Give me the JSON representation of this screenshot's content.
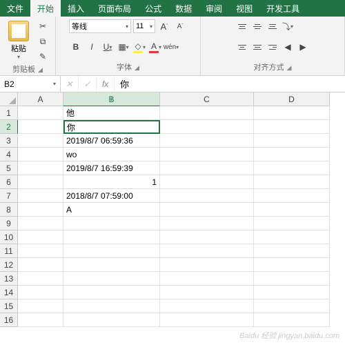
{
  "tabs": [
    "文件",
    "开始",
    "插入",
    "页面布局",
    "公式",
    "数据",
    "审阅",
    "视图",
    "开发工具"
  ],
  "active_tab": 1,
  "clipboard": {
    "paste": "粘贴",
    "label": "剪贴板"
  },
  "font": {
    "family": "等线",
    "size": "11",
    "label": "字体",
    "grow": "A",
    "shrink": "A",
    "bold": "B",
    "italic": "I",
    "underline": "U",
    "wen": "wén"
  },
  "align": {
    "label": "对齐方式"
  },
  "namebox": "B2",
  "formula_fx": "fx",
  "formula_value": "你",
  "columns": [
    "A",
    "B",
    "C",
    "D"
  ],
  "rows_count": 16,
  "active_col": 1,
  "active_row": 2,
  "cells": {
    "B1": "他",
    "B2": "你",
    "B3": "2019/8/7  06:59:36",
    "B4": "wo",
    "B5": "2019/8/7  16:59:39",
    "B6": "1",
    "B7": "2018/8/7  07:59:00",
    "B8": "A"
  },
  "numeric_cells": [
    "B6"
  ],
  "watermark": "Baidu 经验  jingyan.baidu.com"
}
